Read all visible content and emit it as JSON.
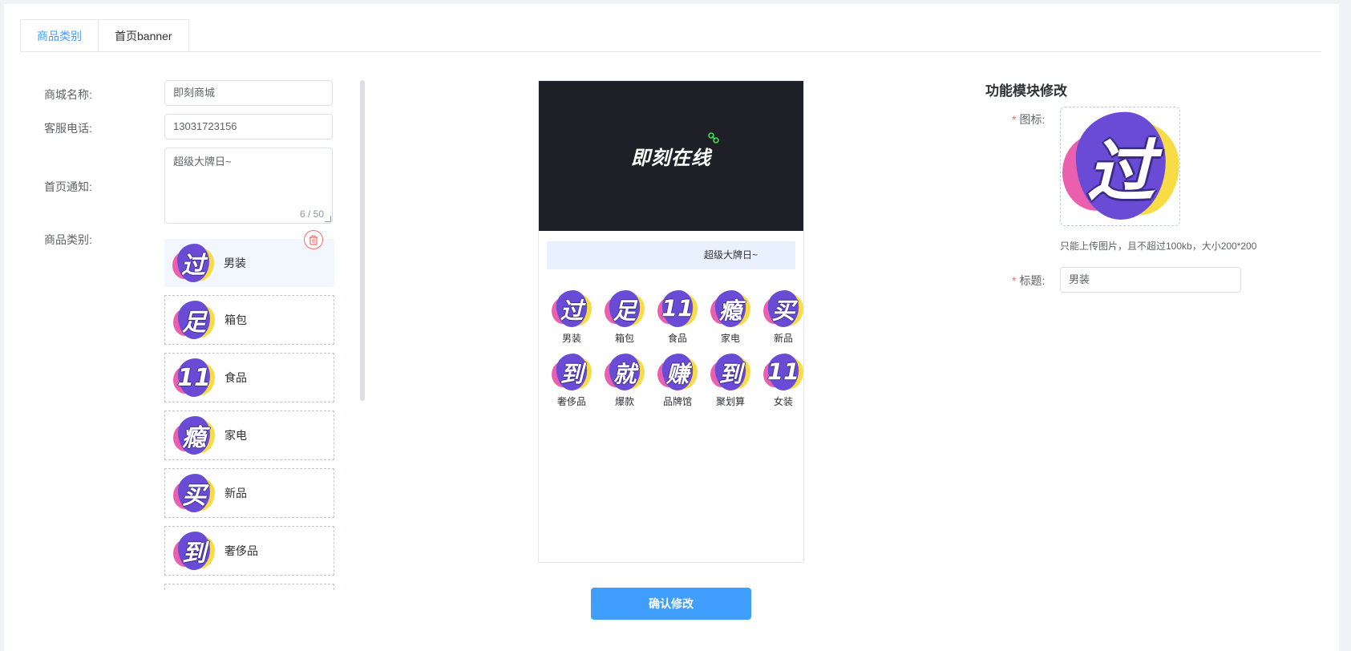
{
  "tabs": [
    {
      "label": "商品类别",
      "active": true
    },
    {
      "label": "首页banner",
      "active": false
    }
  ],
  "form": {
    "mall_name_label": "商城名称:",
    "mall_name_value": "即刻商城",
    "phone_label": "客服电话:",
    "phone_value": "13031723156",
    "notice_label": "首页通知:",
    "notice_value": "超级大牌日~",
    "notice_count": "6 / 50",
    "category_label": "商品类别:"
  },
  "categories": [
    {
      "glyph": "过",
      "name": "男装"
    },
    {
      "glyph": "足",
      "name": "箱包"
    },
    {
      "glyph": "11",
      "name": "食品"
    },
    {
      "glyph": "瘾",
      "name": "家电"
    },
    {
      "glyph": "买",
      "name": "新品"
    },
    {
      "glyph": "到",
      "name": "奢侈品"
    }
  ],
  "preview": {
    "banner_brand": "即刻在线",
    "notice": "超级大牌日~",
    "grid": [
      {
        "glyph": "过",
        "name": "男装"
      },
      {
        "glyph": "足",
        "name": "箱包"
      },
      {
        "glyph": "11",
        "name": "食品"
      },
      {
        "glyph": "瘾",
        "name": "家电"
      },
      {
        "glyph": "买",
        "name": "新品"
      },
      {
        "glyph": "到",
        "name": "奢侈品"
      },
      {
        "glyph": "就",
        "name": "爆款"
      },
      {
        "glyph": "赚",
        "name": "品牌馆"
      },
      {
        "glyph": "到",
        "name": "聚划算"
      },
      {
        "glyph": "11",
        "name": "女装"
      }
    ]
  },
  "confirm_label": "确认修改",
  "right_panel": {
    "title": "功能模块修改",
    "required_mark": "*",
    "icon_label": "图标:",
    "icon_glyph": "过",
    "hint": "只能上传图片，且不超过100kb，大小200*200",
    "title_label": "标题:",
    "title_value": "男装"
  },
  "colors": {
    "primary": "#409eff",
    "danger": "#f56c6c",
    "banner_bg": "#1f2027",
    "notice_bg": "#e8f1fd"
  }
}
